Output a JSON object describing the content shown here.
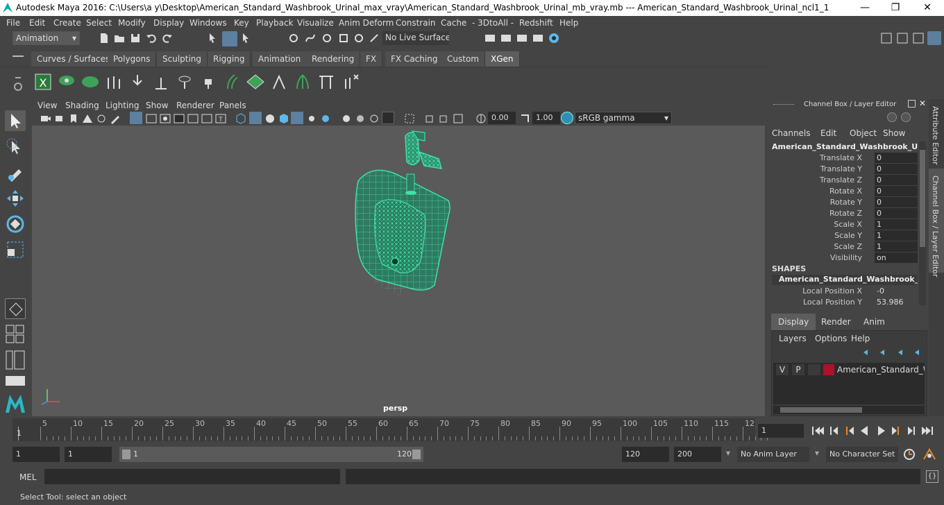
{
  "window": {
    "title": "Autodesk Maya 2016: C:\\Users\\a y\\Desktop\\American_Standard_Washbrook_Urinal_max_vray\\American_Standard_Washbrook_Urinal_mb_vray.mb   ---   American_Standard_Washbrook_Urinal_ncl1_1",
    "minimize": "—",
    "maximize": "❐",
    "close": "✕"
  },
  "menubar": [
    "File",
    "Edit",
    "Create",
    "Select",
    "Modify",
    "Display",
    "Windows",
    "Key",
    "Playback",
    "Visualize",
    "Anim Deform",
    "Constrain",
    "Cache",
    "- 3DtoAll -",
    "Redshift",
    "Help"
  ],
  "statusline": {
    "mode": "Animation",
    "live_surface": "No Live Surface"
  },
  "shelf_tabs": [
    "Curves / Surfaces",
    "Polygons",
    "Sculpting",
    "Rigging",
    "Animation",
    "Rendering",
    "FX",
    "FX Caching",
    "Custom",
    "XGen"
  ],
  "active_shelf_tab": "XGen",
  "panel_menu": [
    "View",
    "Shading",
    "Lighting",
    "Show",
    "Renderer",
    "Panels"
  ],
  "panel_toolbar": {
    "exposure": "0.00",
    "gamma": "1.00",
    "color_space": "sRGB gamma"
  },
  "viewport": {
    "camera_label": "persp",
    "wire_color": "#3fe3a6"
  },
  "channel_box": {
    "header": "Channel Box / Layer Editor",
    "menu": [
      "Channels",
      "Edit",
      "Object",
      "Show"
    ],
    "object_name": "American_Standard_Washbrook_Urin...",
    "channels": [
      {
        "label": "Translate X",
        "value": "0"
      },
      {
        "label": "Translate Y",
        "value": "0"
      },
      {
        "label": "Translate Z",
        "value": "0"
      },
      {
        "label": "Rotate X",
        "value": "0"
      },
      {
        "label": "Rotate Y",
        "value": "0"
      },
      {
        "label": "Rotate Z",
        "value": "0"
      },
      {
        "label": "Scale X",
        "value": "1"
      },
      {
        "label": "Scale Y",
        "value": "1"
      },
      {
        "label": "Scale Z",
        "value": "1"
      },
      {
        "label": "Visibility",
        "value": "on"
      }
    ],
    "shapes_header": "SHAPES",
    "shape_name": "American_Standard_Washbrook_Uri...",
    "shape_channels": [
      {
        "label": "Local Position X",
        "value": "-0"
      },
      {
        "label": "Local Position Y",
        "value": "53.986"
      }
    ]
  },
  "layer_editor": {
    "tabs": [
      "Display",
      "Render",
      "Anim"
    ],
    "active_tab": "Display",
    "menu": [
      "Layers",
      "Options",
      "Help"
    ],
    "layer": {
      "v": "V",
      "p": "P",
      "name": "American_Standard_Was",
      "color": "#b0102a"
    }
  },
  "side_tabs": [
    "Attribute Editor",
    "Channel Box / Layer Editor"
  ],
  "timeline": {
    "ticks": [
      "5",
      "10",
      "15",
      "20",
      "25",
      "30",
      "35",
      "40",
      "45",
      "50",
      "55",
      "60",
      "65",
      "70",
      "75",
      "80",
      "85",
      "90",
      "95",
      "100",
      "105",
      "110",
      "115",
      "12"
    ],
    "start_label": "1",
    "current_frame": "1"
  },
  "range": {
    "start": "1",
    "playback_start": "1",
    "slider_start": "1",
    "slider_end": "120",
    "playback_end": "120",
    "end": "200",
    "anim_layer": "No Anim Layer",
    "character_set": "No Character Set"
  },
  "mel": {
    "label": "MEL"
  },
  "help_line": "Select Tool: select an object"
}
